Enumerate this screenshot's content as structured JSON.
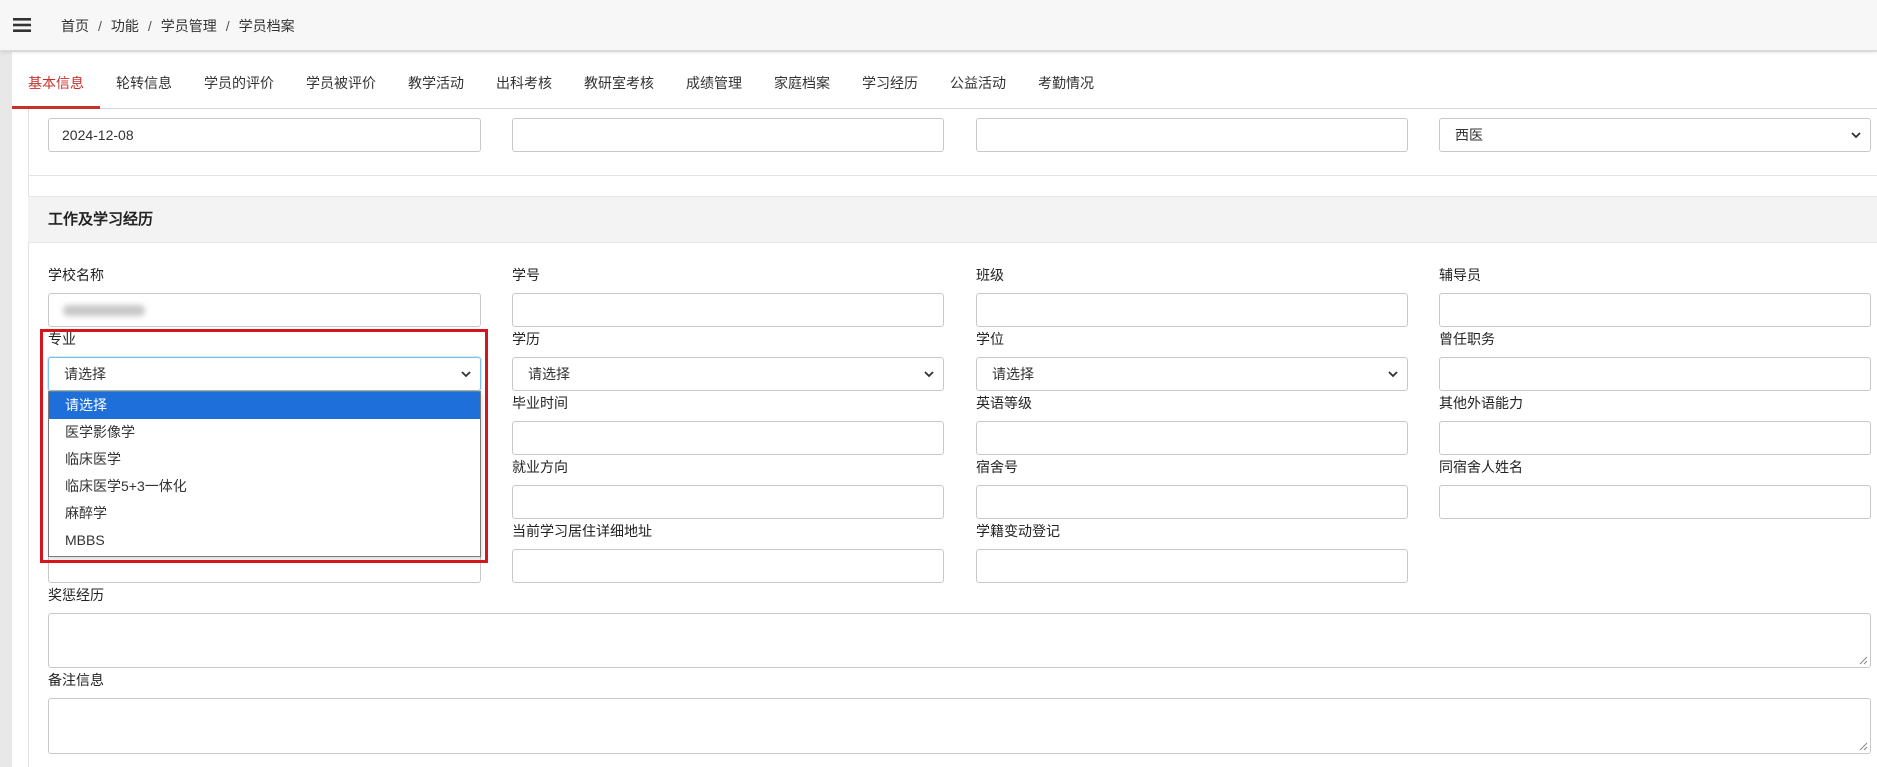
{
  "topbar": {
    "menu_icon": "hamburger-menu-icon",
    "breadcrumb": [
      {
        "label": "首页"
      },
      {
        "label": "功能"
      },
      {
        "label": "学员管理"
      },
      {
        "label": "学员档案"
      }
    ],
    "separator": "/"
  },
  "tabs": [
    {
      "label": "基本信息",
      "active": true
    },
    {
      "label": "轮转信息"
    },
    {
      "label": "学员的评价"
    },
    {
      "label": "学员被评价"
    },
    {
      "label": "教学活动"
    },
    {
      "label": "出科考核"
    },
    {
      "label": "教研室考核"
    },
    {
      "label": "成绩管理"
    },
    {
      "label": "家庭档案"
    },
    {
      "label": "学习经历"
    },
    {
      "label": "公益活动"
    },
    {
      "label": "考勤情况"
    }
  ],
  "prev_row": {
    "date_value": "2024-12-08",
    "select_value": "西医"
  },
  "section_title": "工作及学习经历",
  "fields": {
    "school_name": {
      "label": "学校名称"
    },
    "student_no": {
      "label": "学号"
    },
    "class": {
      "label": "班级"
    },
    "counselor": {
      "label": "辅导员"
    },
    "major": {
      "label": "专业",
      "value": "请选择"
    },
    "education": {
      "label": "学历",
      "value": "请选择"
    },
    "degree": {
      "label": "学位",
      "value": "请选择"
    },
    "former_position": {
      "label": "曾任职务"
    },
    "graduation_time": {
      "label": "毕业时间"
    },
    "english_level": {
      "label": "英语等级"
    },
    "other_language": {
      "label": "其他外语能力"
    },
    "employment_direction": {
      "label": "就业方向"
    },
    "dorm_no": {
      "label": "宿舍号"
    },
    "roommate_names": {
      "label": "同宿舍人姓名"
    },
    "current_address": {
      "label": "当前学习居住详细地址"
    },
    "status_change": {
      "label": "学籍变动登记"
    },
    "rewards": {
      "label": "奖惩经历"
    },
    "remarks": {
      "label": "备注信息"
    }
  },
  "major_dropdown": {
    "open": true,
    "options": [
      "请选择",
      "医学影像学",
      "临床医学",
      "临床医学5+3一体化",
      "麻醉学",
      "MBBS"
    ],
    "highlighted_index": 0
  },
  "colors": {
    "accent_red": "#c9302c",
    "highlight_box": "#d4161c",
    "option_highlight": "#1e6fd9",
    "focus_border": "#7fbfe6"
  }
}
